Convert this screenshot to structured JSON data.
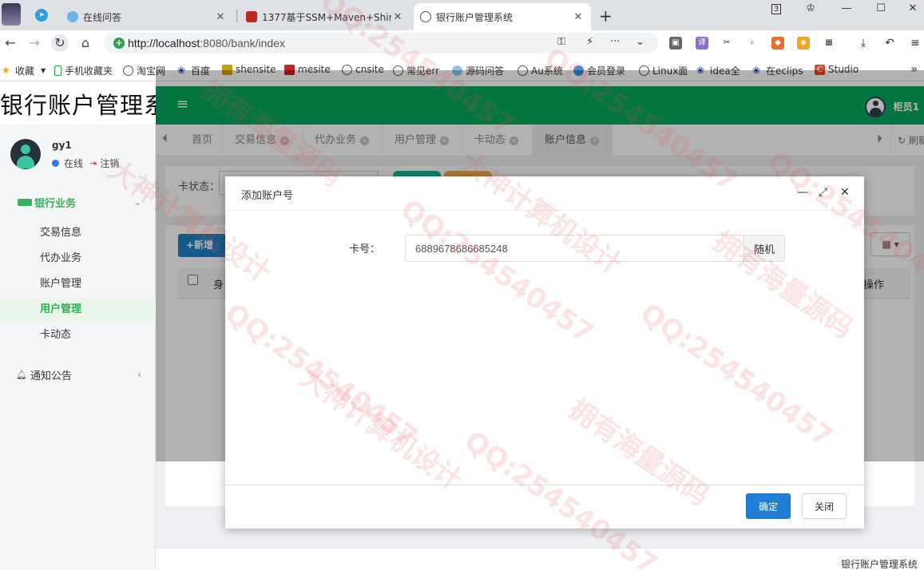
{
  "browser": {
    "tabs": [
      {
        "title": "在线问答"
      },
      {
        "title": "1377基于SSM+Maven+Shir"
      },
      {
        "title": "银行账户管理系统"
      }
    ],
    "badge": "3",
    "url_host": "http://localhost",
    "url_rest": ":8080/bank/index",
    "bookmarks": [
      "收藏",
      "手机收藏夹",
      "淘宝网",
      "百度",
      "shensite",
      "mesite",
      "cnsite",
      "常见err",
      "源码问答",
      "Au系统",
      "会员登录",
      "Linux面",
      "idea全",
      "在eclips",
      "Studio"
    ]
  },
  "app": {
    "logo": "银行账户管理系统",
    "user": {
      "name": "gy1",
      "status": "在线",
      "logout": "注销"
    },
    "menu": {
      "group": "银行业务",
      "items": [
        "交易信息",
        "代办业务",
        "账户管理",
        "用户管理",
        "卡动态"
      ],
      "notice": "通知公告"
    },
    "teller": "柜员1",
    "page_tabs": [
      "首页",
      "交易信息",
      "代办业务",
      "用户管理",
      "卡动态",
      "账户信息"
    ],
    "refresh": "刷新",
    "background": {
      "card_status_label": "卡状态：",
      "add_button": "+新增",
      "col_first": "身",
      "col_action": "操作"
    },
    "footer": "银行账户管理系统"
  },
  "modal": {
    "title": "添加账户号",
    "card_label": "卡号：",
    "card_value": "6889678686685248",
    "random_button": "随机",
    "ok_button": "确定",
    "close_button": "关闭"
  },
  "watermark": {
    "texts": [
      "QQ:254540457",
      "大神计算机设计",
      "拥有海量源码"
    ]
  },
  "colors": {
    "header_green": "#06a65e",
    "active_menu": "#29b34a",
    "ok_blue": "#1e7fd5"
  }
}
